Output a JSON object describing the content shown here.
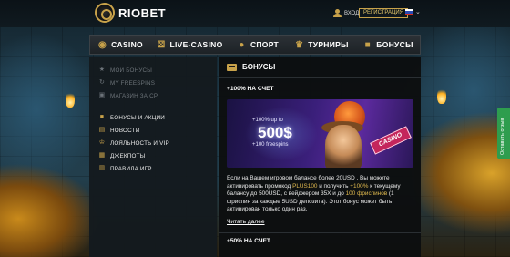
{
  "brand": {
    "name": "RIOBET"
  },
  "header": {
    "login_label": "вход",
    "register_label": "регистрация"
  },
  "nav": {
    "items": [
      {
        "label": "CASINO",
        "icon": "casino-chip-icon"
      },
      {
        "label": "LIVE-CASINO",
        "icon": "dice-icon"
      },
      {
        "label": "СПОРТ",
        "icon": "ball-icon"
      },
      {
        "label": "ТУРНИРЫ",
        "icon": "trophy-icon"
      },
      {
        "label": "БОНУСЫ",
        "icon": "gift-icon"
      }
    ]
  },
  "sidebar": {
    "items": [
      {
        "label": "МОИ БОНУСЫ",
        "icon": "star-icon",
        "enabled": false
      },
      {
        "label": "MY FREESPINS",
        "icon": "spin-icon",
        "enabled": false
      },
      {
        "label": "МАГАЗИН ЗА CP",
        "icon": "cart-icon",
        "enabled": false
      },
      {
        "label": "БОНУСЫ И АКЦИИ",
        "icon": "gift-icon",
        "enabled": true
      },
      {
        "label": "НОВОСТИ",
        "icon": "news-icon",
        "enabled": true
      },
      {
        "label": "ЛОЯЛЬНОСТЬ И VIP",
        "icon": "crown-icon",
        "enabled": true
      },
      {
        "label": "ДЖЕКПОТЫ",
        "icon": "jackpot-icon",
        "enabled": true
      },
      {
        "label": "ПРАВИЛА ИГР",
        "icon": "book-icon",
        "enabled": true
      }
    ]
  },
  "main": {
    "title": "БОНУСЫ",
    "promo1": {
      "title": "+100% НА СЧЕТ",
      "banner": {
        "upto": "+100% up to",
        "amount": "500$",
        "freespins": "+100 freespins",
        "sign": "CASINO"
      },
      "desc_parts": [
        "Если на Вашем игровом балансе более 20USD , Вы можете активировать промокод ",
        "PLUS100",
        " и получить ",
        "+100%",
        " к текущему балансу до 500USD, с вейджером 35Х и до ",
        "100 фриспинов",
        " (1 фриспин за каждые 5USD депозита). Этот бонус может быть активирован только один раз."
      ],
      "more_label": "Читать далее"
    },
    "promo2": {
      "title": "+50% НА СЧЕТ"
    }
  },
  "feedback": {
    "label": "Оставить отзыв"
  },
  "colors": {
    "accent": "#c8a24a",
    "feedback": "#2e9d4e",
    "highlight": "#e0b94e"
  }
}
